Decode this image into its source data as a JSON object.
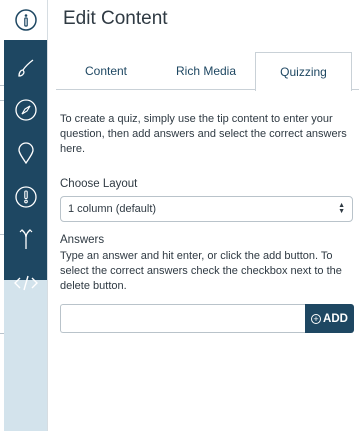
{
  "rail": {
    "items": [
      {
        "icon": "info-icon",
        "active": true
      },
      {
        "icon": "brush-icon"
      },
      {
        "icon": "compass-icon"
      },
      {
        "icon": "map-pin-icon"
      },
      {
        "icon": "alert-icon"
      },
      {
        "icon": "branch-icon"
      },
      {
        "icon": "code-icon"
      }
    ],
    "colors": {
      "dark": "#1e4762",
      "light": "#d3e3ec"
    }
  },
  "panel": {
    "title": "Edit Content",
    "tabs": [
      {
        "label": "Content"
      },
      {
        "label": "Rich Media"
      },
      {
        "label": "Quizzing",
        "selected": true
      }
    ],
    "description": "To create a quiz, simply use the tip content to enter your question, then add answers and select the correct answers here.",
    "layout": {
      "label": "Choose Layout",
      "selected": "1 column (default)"
    },
    "answers": {
      "label": "Answers",
      "help": "Type an answer and hit enter, or click the add button. To select the correct answers check the checkbox next to the delete button.",
      "input_value": "",
      "add_label": "ADD"
    }
  }
}
